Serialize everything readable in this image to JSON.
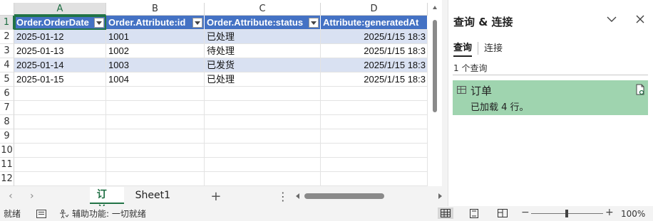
{
  "columns": [
    "A",
    "B",
    "C",
    "D"
  ],
  "active_column": "A",
  "row_numbers": [
    "1",
    "2",
    "3",
    "4",
    "5",
    "6",
    "7",
    "8",
    "9",
    "10",
    "11",
    "12"
  ],
  "headers": [
    "Order.OrderDate",
    "Order.Attribute:id",
    "Order.Attribute:status",
    "Attribute:generatedAt"
  ],
  "rows": [
    [
      "2025-01-12",
      "1001",
      "已处理",
      "2025/1/15 18:3"
    ],
    [
      "2025-01-13",
      "1002",
      "待处理",
      "2025/1/15 18:3"
    ],
    [
      "2025-01-14",
      "1003",
      "已发货",
      "2025/1/15 18:3"
    ],
    [
      "2025-01-15",
      "1004",
      "已处理",
      "2025/1/15 18:3"
    ]
  ],
  "sheet_tabs": [
    "订单",
    "Sheet1"
  ],
  "active_sheet": "订单",
  "add_sheet_label": "+",
  "more_label": "⋮",
  "nav_prev": "‹",
  "nav_next": "›",
  "pane": {
    "title": "查询 & 连接",
    "tabs": [
      "查询",
      "连接"
    ],
    "active_tab": "查询",
    "count_text": "1 个查询",
    "query": {
      "name": "订单",
      "status": "已加载 4 行。"
    }
  },
  "status": {
    "ready": "就绪",
    "accessibility": "辅助功能: 一切就绪",
    "zoom": "100%",
    "zoom_minus": "−",
    "zoom_plus": "+"
  },
  "colors": {
    "header_fill": "#4472c4",
    "band_fill": "#d9e1f2",
    "accent": "#217346",
    "query_card": "#9fd4af"
  }
}
